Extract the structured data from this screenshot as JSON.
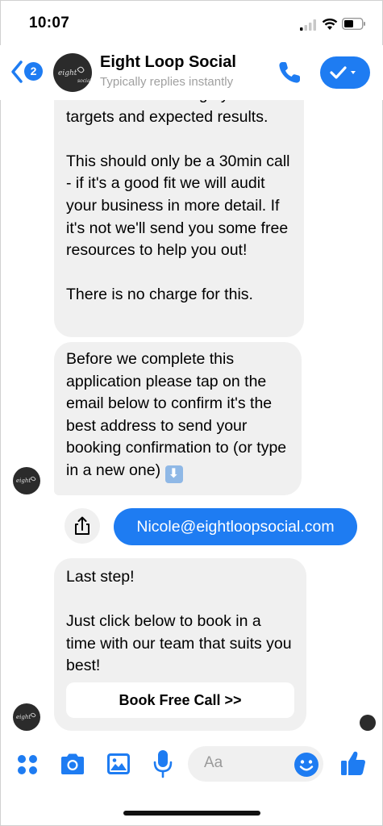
{
  "status": {
    "time": "10:07"
  },
  "header": {
    "unread_count": "2",
    "name": "Eight Loop Social",
    "subtitle": "Typically replies instantly",
    "accent": "#1e7cf2"
  },
  "messages": {
    "bubble1_partial": "time in to talk through your",
    "bubble1": "targets and expected results.\n\nThis should only be a 30min call - if it's a good fit we will audit your business in more detail. If it's not we'll send you some free resources to help you out!\n\nThere is no charge for this.",
    "bubble2": "Before we complete this application please tap on the email below to confirm it's the best address to send your booking confirmation to (or type in a new one)",
    "bubble2_emoji": "⬇",
    "email_reply": "Nicole@eightloopsocial.com",
    "bubble3": "Last step!\n\nJust click below to book in a time with our team that suits you best!",
    "book_button": "Book Free Call >>"
  },
  "composer": {
    "placeholder": "Aa",
    "icons": [
      "apps-icon",
      "camera-icon",
      "photo-icon",
      "microphone-icon",
      "emoji-icon",
      "thumbs-up-icon"
    ]
  }
}
